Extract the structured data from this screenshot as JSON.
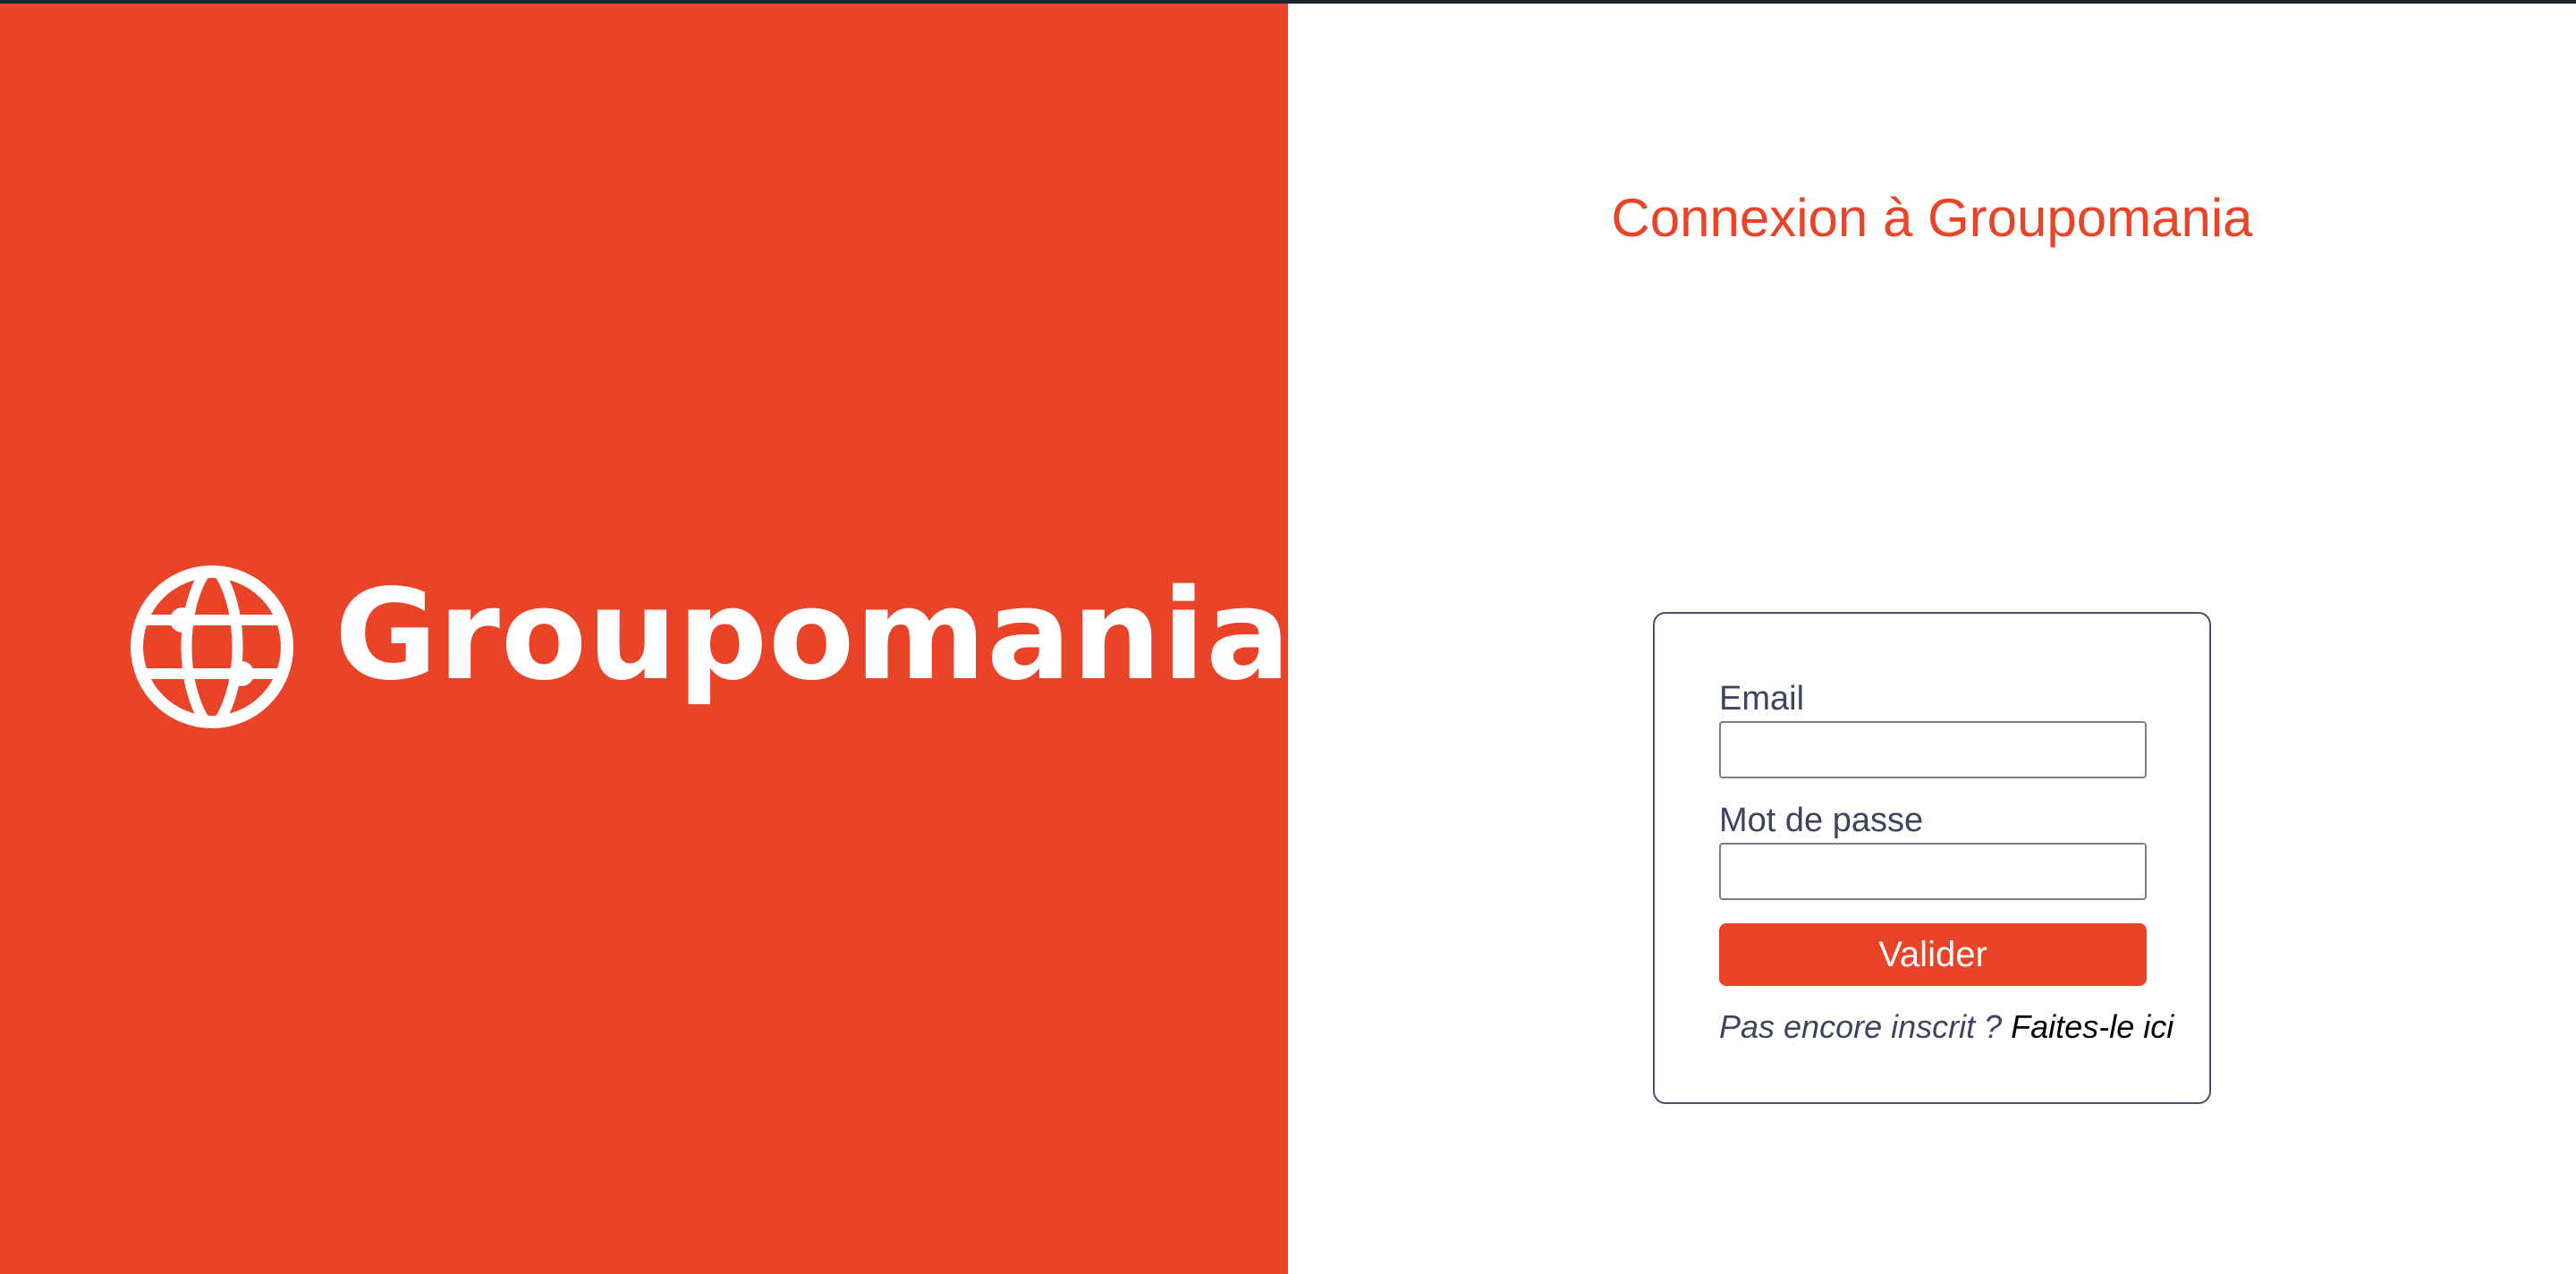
{
  "brand": {
    "logo_text": "Groupomania",
    "logo_icon": "globe-icon",
    "color": "#e94428"
  },
  "login": {
    "title": "Connexion à Groupomania",
    "email_label": "Email",
    "email_value": "",
    "password_label": "Mot de passe",
    "password_value": "",
    "submit_label": "Valider",
    "signup_prompt": "Pas encore inscrit ?",
    "signup_link": "Faites-le ici"
  }
}
